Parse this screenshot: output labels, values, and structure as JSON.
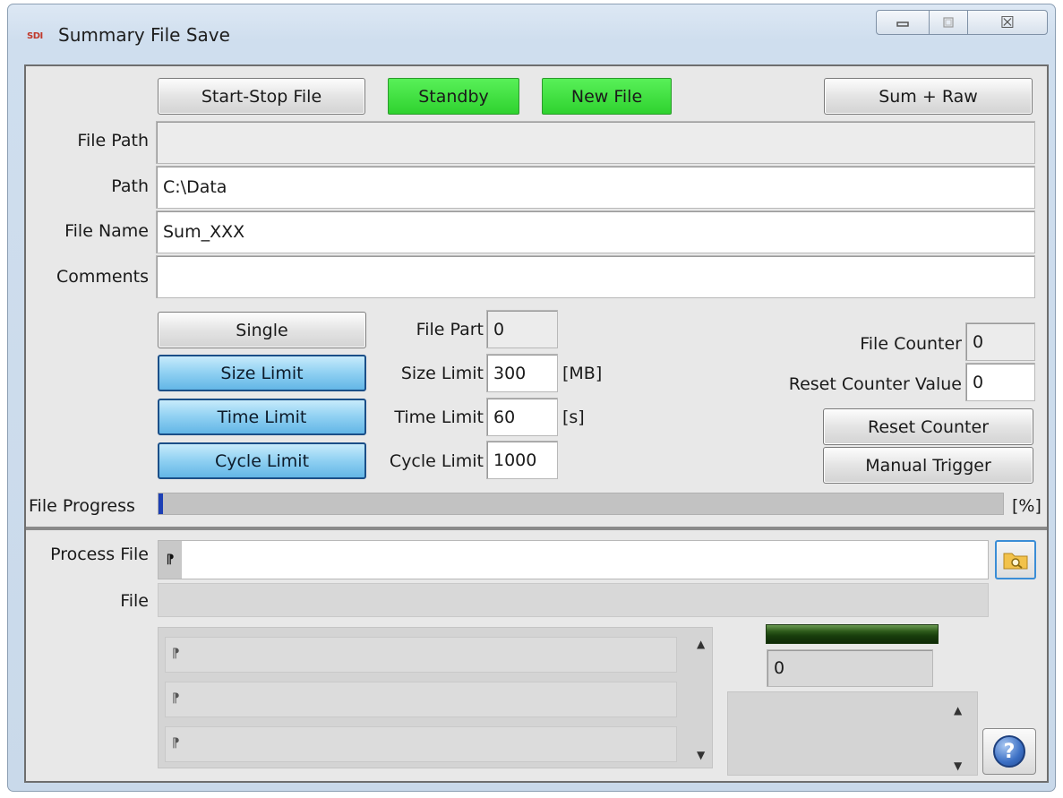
{
  "window": {
    "title": "Summary File Save",
    "app_icon": "sdi-logo-icon",
    "app_icon_text": "SDI",
    "caption_buttons": [
      "minimize-icon",
      "maximize-icon",
      "close-icon"
    ],
    "close_glyph": "☒"
  },
  "toolbar": {
    "start_stop_label": "Start-Stop File",
    "standby_label": "Standby",
    "new_file_label": "New File",
    "sum_raw_label": "Sum + Raw"
  },
  "fields": {
    "file_path_label": "File Path",
    "file_path_value": "",
    "path_label": "Path",
    "path_value": "C:\\Data",
    "file_name_label": "File Name",
    "file_name_value": "Sum_XXX",
    "comments_label": "Comments",
    "comments_value": ""
  },
  "modes": {
    "single_label": "Single",
    "size_limit_label": "Size Limit",
    "time_limit_label": "Time Limit",
    "cycle_limit_label": "Cycle Limit"
  },
  "limits": {
    "file_part_label": "File Part",
    "file_part_value": "0",
    "size_limit_label": "Size Limit",
    "size_limit_value": "300",
    "size_unit": "[MB]",
    "time_limit_label": "Time Limit",
    "time_limit_value": "60",
    "time_unit": "[s]",
    "cycle_limit_label": "Cycle Limit",
    "cycle_limit_value": "1000"
  },
  "counter": {
    "file_counter_label": "File Counter",
    "file_counter_value": "0",
    "reset_value_label": "Reset Counter Value",
    "reset_value_value": "0",
    "reset_button_label": "Reset Counter",
    "manual_trigger_label": "Manual Trigger"
  },
  "progress": {
    "label": "File Progress",
    "unit": "[%]",
    "percent": 0.5,
    "color": "#1c3fb5"
  },
  "process": {
    "process_file_label": "Process File",
    "process_file_value": "",
    "file_label": "File",
    "file_value": "",
    "list_items": [
      "",
      "",
      ""
    ],
    "counter_value": "0",
    "led_color": "#1f4a12",
    "help_glyph": "?"
  },
  "colors": {
    "green_button": "#3fe23f",
    "blue_button": "#8fd0f2",
    "panel": "#e8e8e8"
  }
}
